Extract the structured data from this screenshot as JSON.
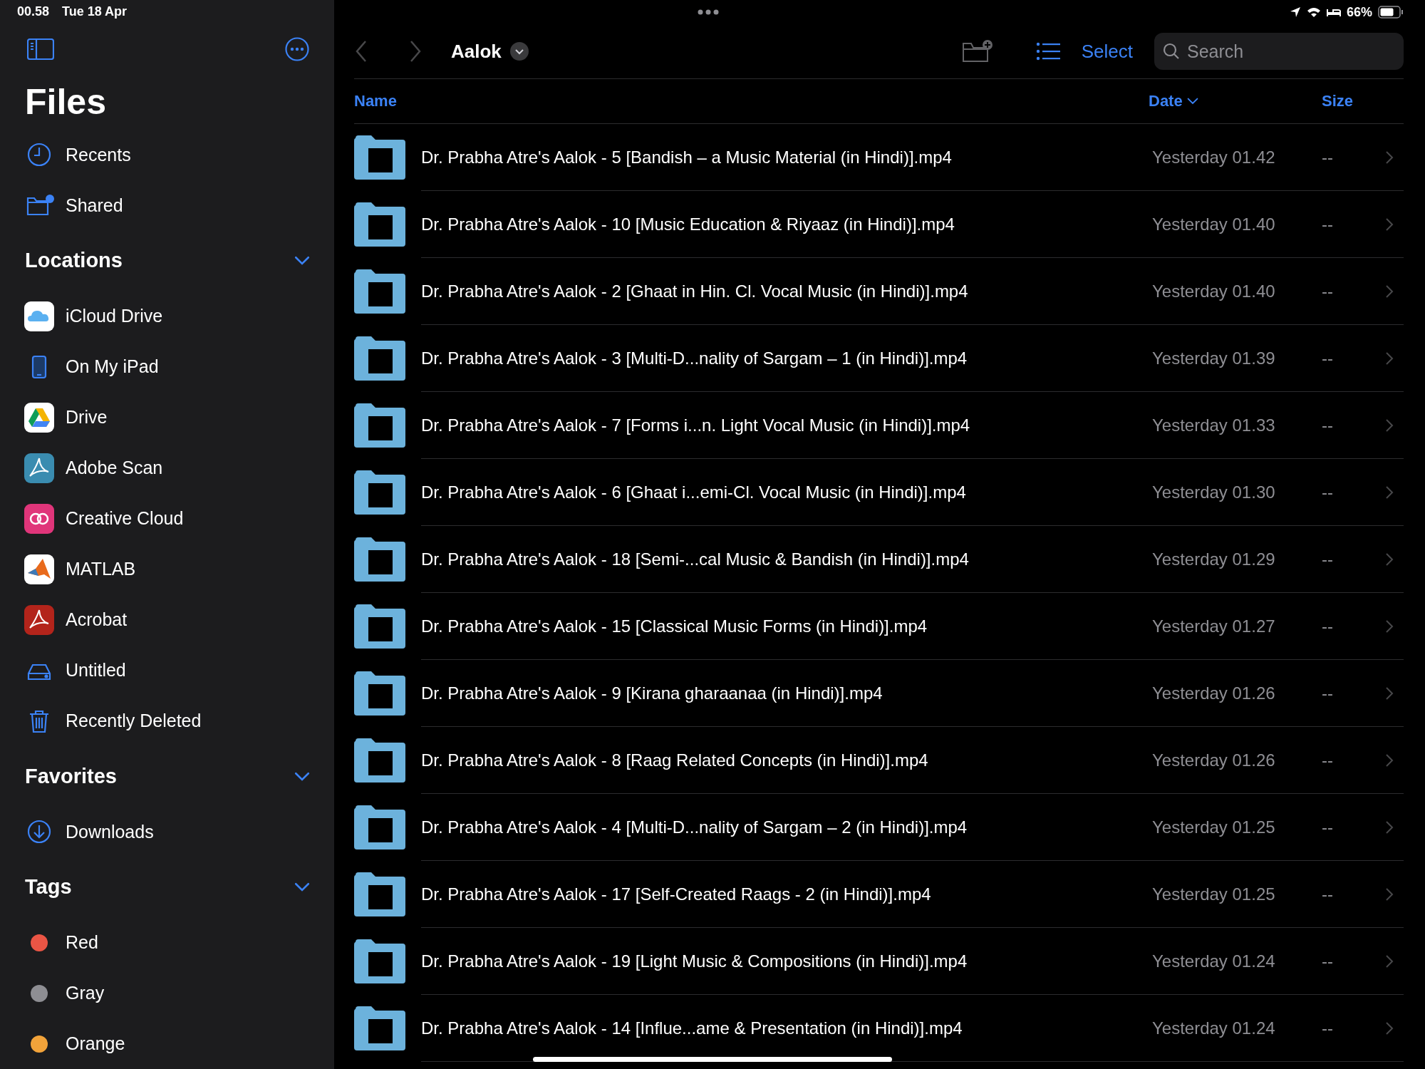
{
  "status_bar": {
    "time": "00.58",
    "date": "Tue 18 Apr",
    "battery": "66%"
  },
  "sidebar": {
    "title": "Files",
    "items": [
      {
        "label": "Recents"
      },
      {
        "label": "Shared"
      }
    ],
    "sections": [
      {
        "title": "Locations",
        "expanded": true,
        "items": [
          {
            "label": "iCloud Drive"
          },
          {
            "label": "On My iPad"
          },
          {
            "label": "Drive"
          },
          {
            "label": "Adobe Scan"
          },
          {
            "label": "Creative Cloud"
          },
          {
            "label": "MATLAB"
          },
          {
            "label": "Acrobat"
          },
          {
            "label": "Untitled"
          },
          {
            "label": "Recently Deleted"
          }
        ]
      },
      {
        "title": "Favorites",
        "expanded": true,
        "items": [
          {
            "label": "Downloads"
          }
        ]
      },
      {
        "title": "Tags",
        "expanded": true,
        "items": [
          {
            "label": "Red",
            "color": "#eb5545"
          },
          {
            "label": "Gray",
            "color": "#8e8e93"
          },
          {
            "label": "Orange",
            "color": "#f2a33a"
          }
        ]
      }
    ]
  },
  "toolbar": {
    "folder": "Aalok",
    "select": "Select",
    "search": {
      "placeholder": "Search"
    }
  },
  "table": {
    "columns": [
      {
        "label": "Name",
        "sorted": false
      },
      {
        "label": "Date",
        "sorted": true
      },
      {
        "label": "Size",
        "sorted": false
      }
    ],
    "rows": [
      {
        "name": "Dr. Prabha Atre's Aalok - 5 [Bandish – a Music Material (in Hindi)].mp4",
        "date": "Yesterday 01.42",
        "size": "--"
      },
      {
        "name": "Dr. Prabha Atre's Aalok - 10 [Music Education & Riyaaz (in Hindi)].mp4",
        "date": "Yesterday 01.40",
        "size": "--"
      },
      {
        "name": "Dr. Prabha Atre's Aalok - 2 [Ghaat in Hin. Cl. Vocal Music (in Hindi)].mp4",
        "date": "Yesterday 01.40",
        "size": "--"
      },
      {
        "name": "Dr. Prabha Atre's Aalok - 3 [Multi-D...nality of Sargam – 1 (in Hindi)].mp4",
        "date": "Yesterday 01.39",
        "size": "--"
      },
      {
        "name": "Dr. Prabha Atre's Aalok - 7 [Forms i...n. Light Vocal Music (in Hindi)].mp4",
        "date": "Yesterday 01.33",
        "size": "--"
      },
      {
        "name": "Dr. Prabha Atre's Aalok - 6 [Ghaat i...emi-Cl. Vocal Music (in Hindi)].mp4",
        "date": "Yesterday 01.30",
        "size": "--"
      },
      {
        "name": "Dr. Prabha Atre's Aalok - 18 [Semi-...cal Music & Bandish (in Hindi)].mp4",
        "date": "Yesterday 01.29",
        "size": "--"
      },
      {
        "name": "Dr. Prabha Atre's Aalok - 15 [Classical Music Forms (in Hindi)].mp4",
        "date": "Yesterday 01.27",
        "size": "--"
      },
      {
        "name": "Dr. Prabha Atre's Aalok - 9 [Kirana gharaanaa (in Hindi)].mp4",
        "date": "Yesterday 01.26",
        "size": "--"
      },
      {
        "name": "Dr. Prabha Atre's Aalok - 8 [Raag Related Concepts (in Hindi)].mp4",
        "date": "Yesterday 01.26",
        "size": "--"
      },
      {
        "name": "Dr. Prabha Atre's Aalok - 4 [Multi-D...nality of Sargam – 2 (in Hindi)].mp4",
        "date": "Yesterday 01.25",
        "size": "--"
      },
      {
        "name": "Dr. Prabha Atre's Aalok - 17 [Self-Created Raags - 2 (in Hindi)].mp4",
        "date": "Yesterday 01.25",
        "size": "--"
      },
      {
        "name": "Dr. Prabha Atre's Aalok - 19 [Light Music & Compositions (in Hindi)].mp4",
        "date": "Yesterday 01.24",
        "size": "--"
      },
      {
        "name": "Dr. Prabha Atre's Aalok - 14 [Influe...ame & Presentation (in Hindi)].mp4",
        "date": "Yesterday 01.24",
        "size": "--"
      }
    ]
  }
}
